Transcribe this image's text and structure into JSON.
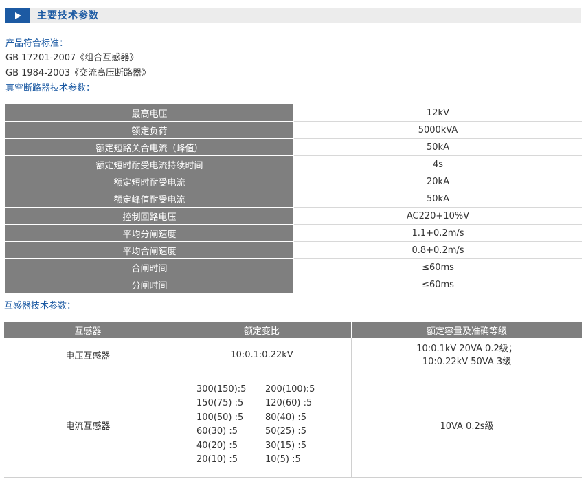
{
  "header": {
    "title": "主要技术参数"
  },
  "standards": {
    "heading": "产品符合标准：",
    "items": [
      "GB 17201-2007《组合互感器》",
      "GB 1984-2003《交流高压断路器》"
    ]
  },
  "breaker": {
    "heading": "真空断路器技术参数：",
    "rows": [
      {
        "name": "最高电压",
        "value": "12kV"
      },
      {
        "name": "额定负荷",
        "value": "5000kVA"
      },
      {
        "name": "额定短路关合电流（峰值）",
        "value": "50kA"
      },
      {
        "name": "额定短时耐受电流持续时间",
        "value": "4s"
      },
      {
        "name": "额定短时耐受电流",
        "value": "20kA"
      },
      {
        "name": "额定峰值耐受电流",
        "value": "50kA"
      },
      {
        "name": "控制回路电压",
        "value": "AC220+10%V"
      },
      {
        "name": "平均分闸速度",
        "value": "1.1+0.2m/s"
      },
      {
        "name": "平均合闸速度",
        "value": "0.8+0.2m/s"
      },
      {
        "name": "合闸时间",
        "value": "≤60ms"
      },
      {
        "name": "分闸时间",
        "value": "≤60ms"
      }
    ]
  },
  "transformer": {
    "heading": "互感器技术参数：",
    "columns": [
      "互感器",
      "额定变比",
      "额定容量及准确等级"
    ],
    "voltage": {
      "name": "电压互感器",
      "ratio": "10:0.1:0.22kV",
      "capacity": [
        "10:0.1kV 20VA 0.2级；",
        "10:0.22kV 50VA 3级"
      ]
    },
    "current": {
      "name": "电流互感器",
      "ratios": [
        "300(150):5",
        "200(100):5",
        "150(75) :5",
        "120(60) :5",
        "100(50) :5",
        "80(40) :5",
        "60(30) :5",
        "50(25) :5",
        "40(20) :5",
        "30(15) :5",
        "20(10) :5",
        "10(5) :5"
      ],
      "capacity": "10VA 0.2s级"
    }
  }
}
